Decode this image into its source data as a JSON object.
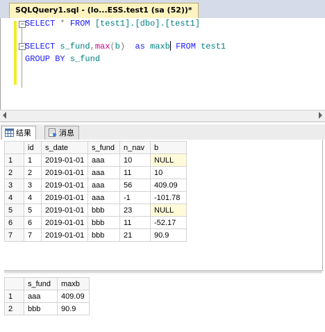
{
  "document_tab": {
    "title": "SQLQuery1.sql - (lo...ESS.test1 (sa (52))*"
  },
  "editor": {
    "line1": {
      "kw1": "SELECT",
      "star": " * ",
      "kw2": "FROM",
      "sp": " ",
      "obj": "[test1].[dbo].[test1]"
    },
    "line3": {
      "kw1": "SELECT",
      "sp1": " ",
      "col1": "s_fund",
      "comma": ",",
      "fn": "max",
      "paren_open": "(",
      "arg": "b",
      "paren_close": ")",
      "sp2": "  ",
      "kw_as": "as",
      "sp3": " ",
      "alias": "maxb",
      "sp4": " ",
      "kw_from": "FROM",
      "sp5": " ",
      "table": "test1"
    },
    "line4": {
      "kw": "GROUP BY",
      "sp": " ",
      "col": "s_fund"
    }
  },
  "result_tabs": {
    "results": "结果",
    "messages": "消息"
  },
  "grid1": {
    "columns": [
      "id",
      "s_date",
      "s_fund",
      "n_nav",
      "b"
    ],
    "rows": [
      [
        "1",
        "1",
        "2019-01-01",
        "aaa",
        "10",
        "NULL"
      ],
      [
        "2",
        "2",
        "2019-01-01",
        "aaa",
        "11",
        "10"
      ],
      [
        "3",
        "3",
        "2019-01-01",
        "aaa",
        "56",
        "409.09"
      ],
      [
        "4",
        "4",
        "2019-01-01",
        "aaa",
        "-1",
        "-101.78"
      ],
      [
        "5",
        "5",
        "2019-01-01",
        "bbb",
        "23",
        "NULL"
      ],
      [
        "6",
        "6",
        "2019-01-01",
        "bbb",
        "11",
        "-52.17"
      ],
      [
        "7",
        "7",
        "2019-01-01",
        "bbb",
        "21",
        "90.9"
      ]
    ]
  },
  "grid2": {
    "columns": [
      "s_fund",
      "maxb"
    ],
    "rows": [
      [
        "1",
        "aaa",
        "409.09"
      ],
      [
        "2",
        "bbb",
        "90.9"
      ]
    ]
  },
  "colors": {
    "null_cell": "#fffbd9",
    "keyword": "#1a1aff",
    "function": "#d1008f",
    "identifier": "#008080",
    "change_bar": "#f3ec25",
    "tab_active": "#fdf4c0"
  }
}
